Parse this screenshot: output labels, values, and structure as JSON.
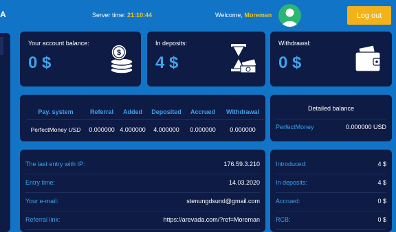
{
  "header": {
    "logo_fragment": "A",
    "server_time_label": "Server time:",
    "server_time": "21:10:44",
    "welcome_label": "Welcome,",
    "username": "Moreman",
    "logout_label": "Log out"
  },
  "stats": [
    {
      "label": "Your account balance:",
      "value": "0 $",
      "icon": "coins-stack-icon"
    },
    {
      "label": "In deposits:",
      "value": "4 $",
      "icon": "hourglass-money-icon"
    },
    {
      "label": "Withdrawal:",
      "value": "0 $",
      "icon": "wallet-icon"
    }
  ],
  "payment_table": {
    "headers": [
      "Pay. system",
      "Referral",
      "Added",
      "Deposited",
      "Accrued",
      "Withdrawal"
    ],
    "rows": [
      {
        "system": "PerfectMoney",
        "currency": "USD",
        "referral": "0.000000",
        "added": "4.000000",
        "deposited": "4.000000",
        "accrued": "0.000000",
        "withdrawal": "0.000000"
      }
    ]
  },
  "detailed_balance": {
    "title": "Detailed balance",
    "system": "PerfectMoney",
    "value": "0.000000 USD"
  },
  "account_info": [
    {
      "key": "The last entry with IP:",
      "value": "176.59.3.210"
    },
    {
      "key": "Entry time:",
      "value": "14.03.2020"
    },
    {
      "key": "Your e-mail:",
      "value": "stenungdsund@gmail.com"
    },
    {
      "key": "Referral link:",
      "value": "https://arevada.com/?ref=Moreman"
    }
  ],
  "summary": [
    {
      "key": "Introduced:",
      "value": "4 $"
    },
    {
      "key": "In deposits:",
      "value": "4 $"
    },
    {
      "key": "Accrued:",
      "value": "0 $"
    },
    {
      "key": "RCB:",
      "value": "0 $"
    }
  ]
}
